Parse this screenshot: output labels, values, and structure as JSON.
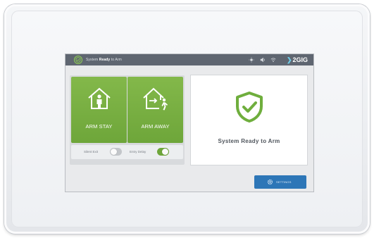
{
  "status_bar": {
    "status_prefix": "System",
    "status_bold": "Ready",
    "status_suffix": "to Arm",
    "brand": "2GIG"
  },
  "arm_tiles": {
    "stay_label": "ARM STAY",
    "away_label": "ARM AWAY"
  },
  "options": {
    "silent_exit_label": "Silent Exit",
    "entry_delay_label": "Entry Delay",
    "silent_exit_on": false,
    "entry_delay_on": true
  },
  "status_panel": {
    "message": "System Ready to Arm"
  },
  "settings_button": {
    "label": "SETTINGS"
  },
  "colors": {
    "arm_green": "#6ea63a",
    "shield_green": "#6fae3d",
    "topbar_gray": "#5f6671",
    "settings_blue": "#2d76b7"
  },
  "icons": {
    "status": "shield-check-icon",
    "stay": "house-person-icon",
    "away": "house-exit-icon",
    "settings": "gear-icon"
  }
}
